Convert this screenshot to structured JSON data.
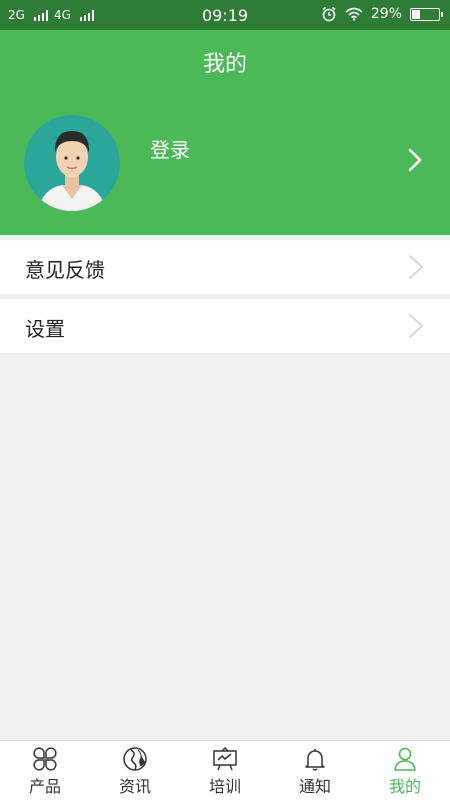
{
  "status_bar": {
    "network_1": "2G",
    "network_2": "4G",
    "time": "09:19",
    "battery_text": "29%",
    "battery_level": 0.29
  },
  "header": {
    "title": "我的",
    "login_label": "登录"
  },
  "menu": [
    {
      "label": "意见反馈"
    },
    {
      "label": "设置"
    }
  ],
  "tabbar": {
    "tabs": [
      {
        "label": "产品",
        "icon": "grid-petals-icon"
      },
      {
        "label": "资讯",
        "icon": "globe-icon"
      },
      {
        "label": "培训",
        "icon": "presentation-board-icon"
      },
      {
        "label": "通知",
        "icon": "bell-icon"
      },
      {
        "label": "我的",
        "icon": "user-icon"
      }
    ],
    "active_index": 4
  },
  "colors": {
    "status_bar": "#2f7d34",
    "header": "#4bb957",
    "active_tab": "#4bb957",
    "avatar_bg": "#2aa69b",
    "page_bg": "#f0f0f0"
  }
}
